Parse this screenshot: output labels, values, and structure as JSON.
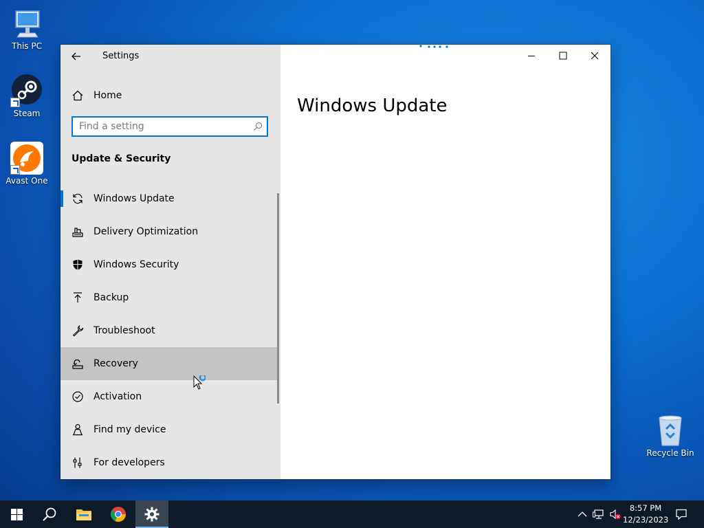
{
  "desktop": {
    "icons": [
      {
        "label": "This PC",
        "icon": "this-pc-icon"
      },
      {
        "label": "Steam",
        "icon": "steam-icon"
      },
      {
        "label": "Avast One",
        "icon": "avast-one-icon"
      },
      {
        "label": "Recycle Bin",
        "icon": "recycle-bin-icon"
      }
    ]
  },
  "window": {
    "app_title": "Settings",
    "home_label": "Home",
    "search": {
      "placeholder": "Find a setting",
      "value": ""
    },
    "section_title": "Update & Security",
    "nav_items": [
      {
        "label": "Windows Update",
        "icon": "refresh-icon",
        "selected": true
      },
      {
        "label": "Delivery Optimization",
        "icon": "delivery-optimization-icon"
      },
      {
        "label": "Windows Security",
        "icon": "shield-icon"
      },
      {
        "label": "Backup",
        "icon": "backup-arrow-icon"
      },
      {
        "label": "Troubleshoot",
        "icon": "wrench-icon"
      },
      {
        "label": "Recovery",
        "icon": "recovery-icon",
        "hovered": true
      },
      {
        "label": "Activation",
        "icon": "check-circle-icon"
      },
      {
        "label": "Find my device",
        "icon": "person-location-icon"
      },
      {
        "label": "For developers",
        "icon": "developer-tools-icon"
      }
    ],
    "page_title": "Windows Update"
  },
  "taskbar": {
    "apps": [
      "start-icon",
      "search-icon",
      "file-explorer-icon",
      "chrome-icon",
      "settings-gear-icon"
    ],
    "clock": {
      "time": "8:57 PM",
      "date": "12/23/2023"
    }
  },
  "colors": {
    "accent": "#0078d7",
    "sidebar_bg": "#e6e6e6",
    "taskbar_bg": "#0f1a28"
  }
}
